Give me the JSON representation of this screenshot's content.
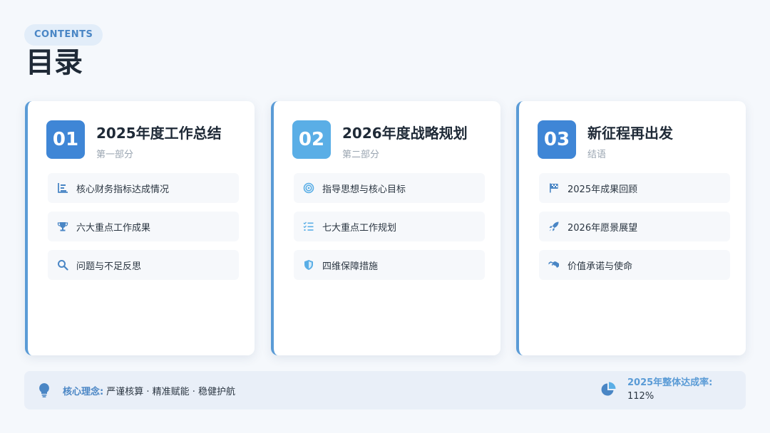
{
  "header": {
    "badge": "CONTENTS",
    "title": "目录"
  },
  "sections": [
    {
      "number": "01",
      "title": "2025年度工作总结",
      "subtitle": "第一部分",
      "color": "#3f86d6",
      "items": [
        {
          "label": "核心财务指标达成情况",
          "icon": "bar-chart-icon"
        },
        {
          "label": "六大重点工作成果",
          "icon": "trophy-icon"
        },
        {
          "label": "问题与不足反思",
          "icon": "search-icon"
        }
      ]
    },
    {
      "number": "02",
      "title": "2026年度战略规划",
      "subtitle": "第二部分",
      "color": "#5aaee6",
      "items": [
        {
          "label": "指导思想与核心目标",
          "icon": "target-icon"
        },
        {
          "label": "七大重点工作规划",
          "icon": "checklist-icon"
        },
        {
          "label": "四维保障措施",
          "icon": "shield-icon"
        }
      ]
    },
    {
      "number": "03",
      "title": "新征程再出发",
      "subtitle": "结语",
      "color": "#3f86d6",
      "items": [
        {
          "label": "2025年成果回顾",
          "icon": "flag-icon"
        },
        {
          "label": "2026年愿景展望",
          "icon": "rocket-icon"
        },
        {
          "label": "价值承诺与使命",
          "icon": "handshake-icon"
        }
      ]
    }
  ],
  "footer": {
    "concept_label": "核心理念:",
    "concept_text": "严谨核算 · 精准赋能 · 稳健护航",
    "rate_label": "2025年整体达成率:",
    "rate_value": "112%",
    "accent": "#4a86c5"
  }
}
